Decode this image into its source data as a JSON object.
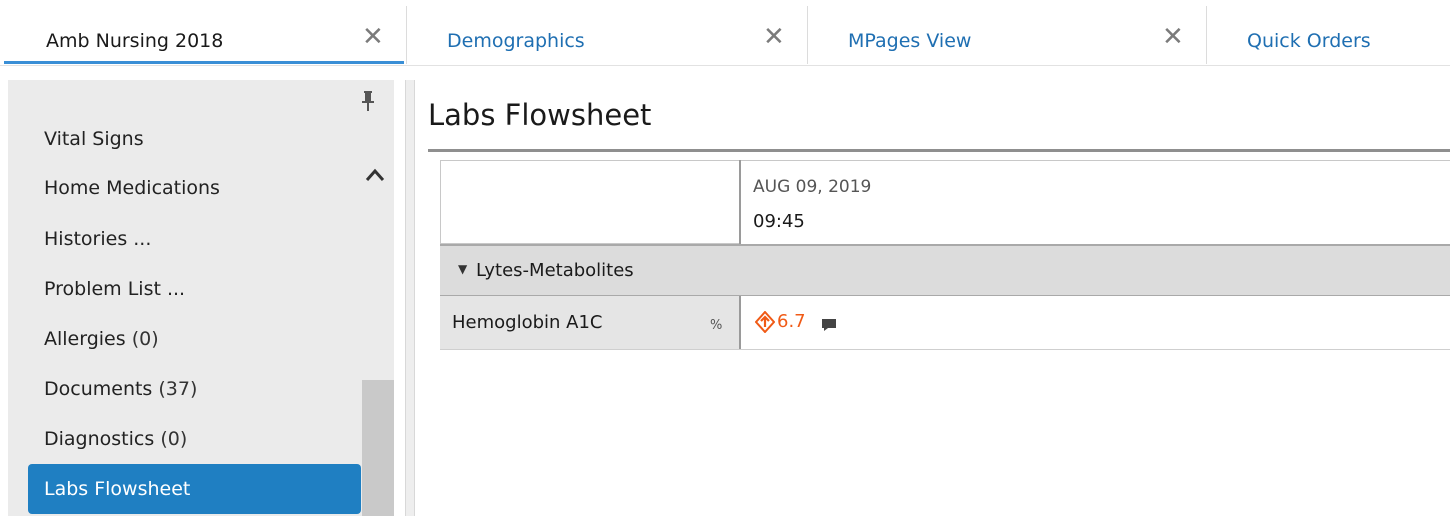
{
  "tabs": [
    {
      "label": "Amb Nursing 2018",
      "active": true,
      "closable": true
    },
    {
      "label": "Demographics",
      "active": false,
      "closable": true
    },
    {
      "label": "MPages View",
      "active": false,
      "closable": true
    },
    {
      "label": "Quick Orders",
      "active": false,
      "closable": false
    }
  ],
  "close_glyph": "✕",
  "colors": {
    "tab_active_text": "#1a1a1a",
    "tab_link_text": "#1f6fb2",
    "accent": "#1f7fc2",
    "abnormal_value": "#f05a16"
  },
  "sidebar": {
    "items": [
      {
        "label": "Vital Signs",
        "count": ""
      },
      {
        "label": "Home Medications",
        "count": ""
      },
      {
        "label": "Histories ...",
        "count": ""
      },
      {
        "label": "Problem List ...",
        "count": ""
      },
      {
        "label": "Allergies",
        "count": "(0)"
      },
      {
        "label": "Documents",
        "count": "(37)"
      },
      {
        "label": "Diagnostics",
        "count": "(0)"
      }
    ],
    "active_item": "Labs Flowsheet",
    "icons": [
      "pin-icon",
      "chevron-up-icon"
    ]
  },
  "main": {
    "title": "Labs Flowsheet",
    "column": {
      "date": "AUG 09, 2019",
      "time": "09:45"
    },
    "section": {
      "label": "Lytes-Metabolites",
      "expanded": true
    },
    "rows": [
      {
        "label": "Hemoglobin A1C",
        "unit": "%",
        "value": "6.7",
        "flag": "high",
        "has_comment": true
      }
    ]
  }
}
